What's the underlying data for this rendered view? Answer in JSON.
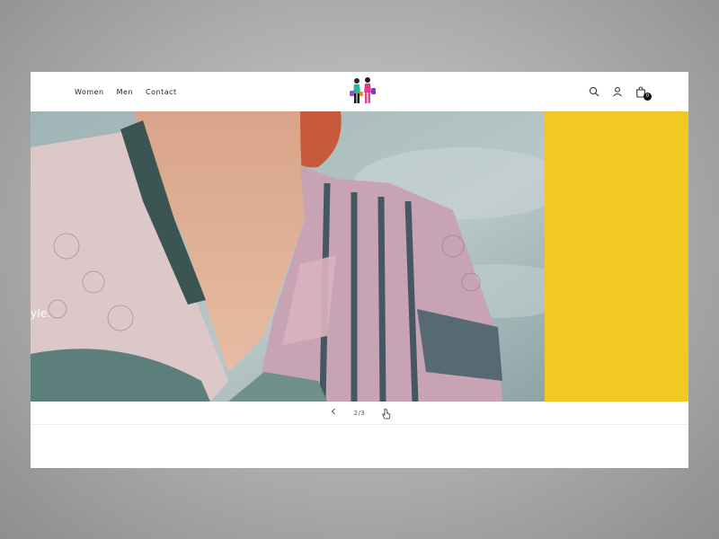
{
  "nav": {
    "women": "Women",
    "men": "Men",
    "contact": "Contact"
  },
  "header": {
    "logo": "shopping-women-logo",
    "icons": [
      "search-icon",
      "account-icon",
      "cart-icon"
    ],
    "cart_count": "0"
  },
  "hero": {
    "caption": "yle.",
    "accent_color": "#f2c824"
  },
  "slider": {
    "prev_icon": "chevron-left-icon",
    "next_icon": "chevron-right-icon",
    "counter": "2/3"
  }
}
